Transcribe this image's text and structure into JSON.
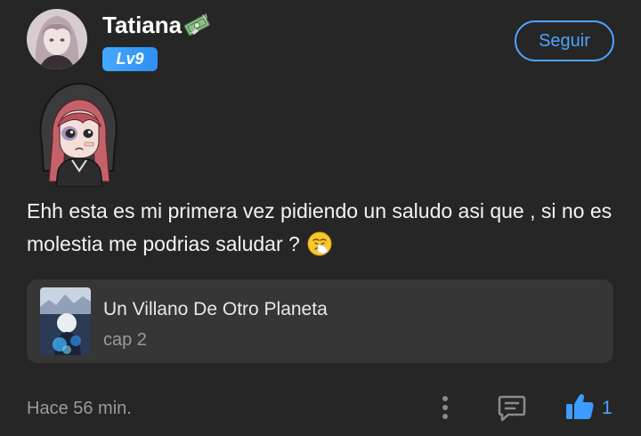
{
  "post": {
    "author": {
      "name": "Tatiana",
      "level": "Lv9",
      "badge_icon": "money-icon",
      "avatar_icon": "user-avatar"
    },
    "follow_label": "Seguir",
    "sticker_icon": "hooded-girl-sticker",
    "text": "Ehh esta es mi primera vez pidiendo un saludo asi que , si no es molestia me podrias saludar ?",
    "text_emoji": "sneezing-face-emoji",
    "linked_story": {
      "title": "Un Villano De Otro Planeta",
      "chapter": "cap 2",
      "cover_icon": "story-cover"
    },
    "footer": {
      "timestamp": "Hace 56 min.",
      "like_count": "1",
      "icons": [
        "more-vertical-icon",
        "comment-icon",
        "thumbs-up-icon"
      ]
    },
    "colors": {
      "background": "#262626",
      "card": "#363636",
      "accent": "#4ea3ff",
      "badge": "#3a9cfa",
      "muted": "#9a9a9a"
    }
  }
}
